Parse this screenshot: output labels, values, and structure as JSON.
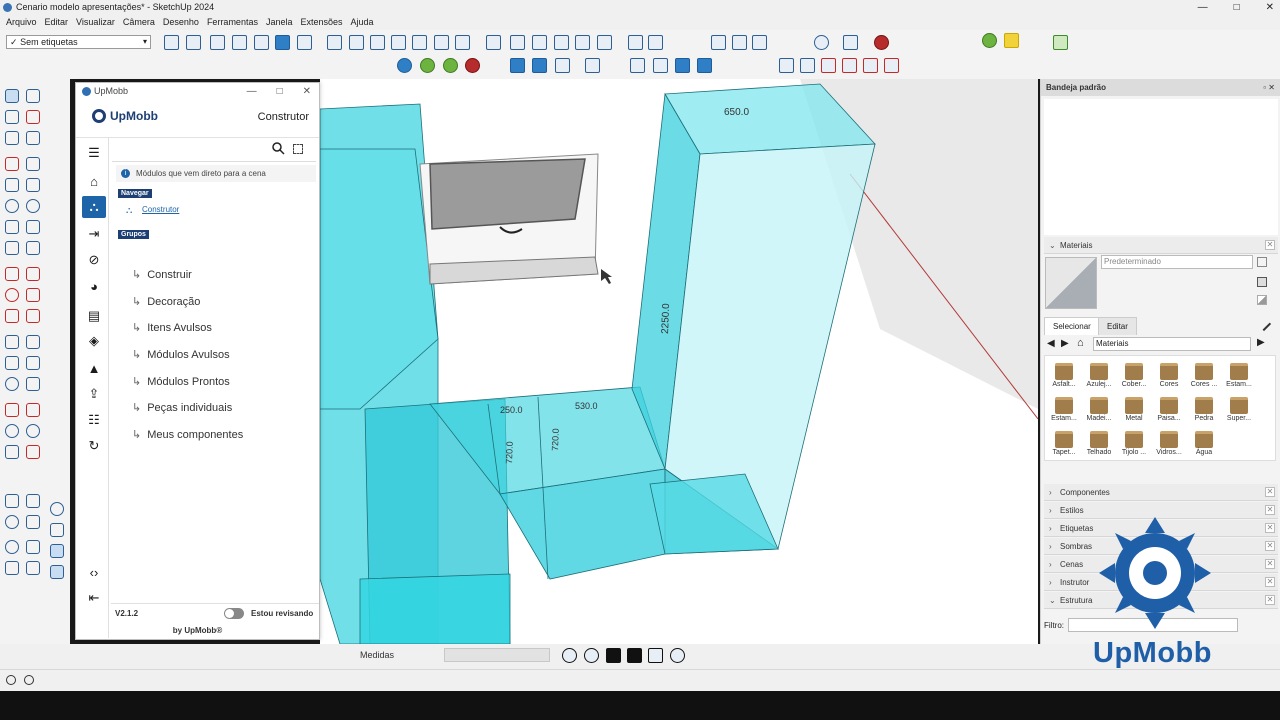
{
  "window": {
    "title": "Cenario modelo apresentações* - SketchUp 2024",
    "controls": [
      "—",
      "□",
      "✕"
    ]
  },
  "menu": [
    "Arquivo",
    "Editar",
    "Visualizar",
    "Câmera",
    "Desenho",
    "Ferramentas",
    "Janela",
    "Extensões",
    "Ajuda"
  ],
  "tag_selector": {
    "check": "✓",
    "value": "Sem etiquetas",
    "chevron": "▾"
  },
  "plugin": {
    "window_title": "UpMobb",
    "window_controls": [
      "—",
      "□",
      "✕"
    ],
    "brand": "UpMobb",
    "header_title": "Construtor",
    "info_text": "Módulos que vem direto para a cena",
    "info_icon": "i",
    "navegar_tag": "Navegar",
    "nav_link": "Construtor",
    "grupos_tag": "Grupos",
    "groups": [
      "Construir",
      "Decoração",
      "Itens Avulsos",
      "Módulos Avulsos",
      "Módulos Prontos",
      "Peças individuais",
      "Meus componentes"
    ],
    "group_arrow": "↳",
    "sidebar_icons": [
      "menu-icon",
      "home-icon",
      "hierarchy-icon",
      "import-icon",
      "disable-icon",
      "palette-icon",
      "document-icon",
      "layers-icon",
      "warning-icon",
      "export-icon",
      "settings-sliders-icon",
      "refresh-icon",
      "code-icon",
      "logout-icon"
    ],
    "sidebar_glyphs": {
      "menu": "☰",
      "home": "⌂",
      "hier": "⛬",
      "import": "⇥",
      "disable": "⊘",
      "palette": "◕",
      "doc": "▤",
      "layers": "◈",
      "warn": "▲",
      "export": "⇪",
      "sliders": "☷",
      "refresh": "↻",
      "code": "‹›",
      "logout": "⇤"
    },
    "version": "V2.1.2",
    "toggle_label": "Estou revisando",
    "byline": "by UpMobb®"
  },
  "viewport": {
    "dimensions": [
      "650.0",
      "2250.0",
      "250.0",
      "530.0",
      "720.0",
      "720.0"
    ]
  },
  "tray": {
    "title": "Bandeja padrão",
    "title_controls": "▫ ✕",
    "materials": {
      "header": "Materiais",
      "name_placeholder": "Predeterminado",
      "tabs": [
        "Selecionar",
        "Editar"
      ],
      "library": "Materiais",
      "items": [
        "Asfalt...",
        "Azulej...",
        "Cober...",
        "Cores",
        "Cores ...",
        "Estam...",
        "Estam...",
        "Madei...",
        "Metal",
        "Paisa...",
        "Pedra",
        "Super...",
        "Tapet...",
        "Telhado",
        "Tijolo ...",
        "Vidros...",
        "Água"
      ]
    },
    "sections": [
      "Componentes",
      "Estilos",
      "Etiquetas",
      "Sombras",
      "Cenas",
      "Instrutor",
      "Estrutura"
    ],
    "collapsed_caret": "›",
    "expanded_caret": "⌄",
    "close_glyph": "✕",
    "filter_label": "Filtro:"
  },
  "status": {
    "measures_label": "Medidas"
  },
  "watermark": {
    "text": "UpMobb"
  },
  "colors": {
    "accent": "#1e64a8",
    "brand": "#1d3f73",
    "glass": "#35d3e0",
    "watermark": "#1f5fa8"
  }
}
